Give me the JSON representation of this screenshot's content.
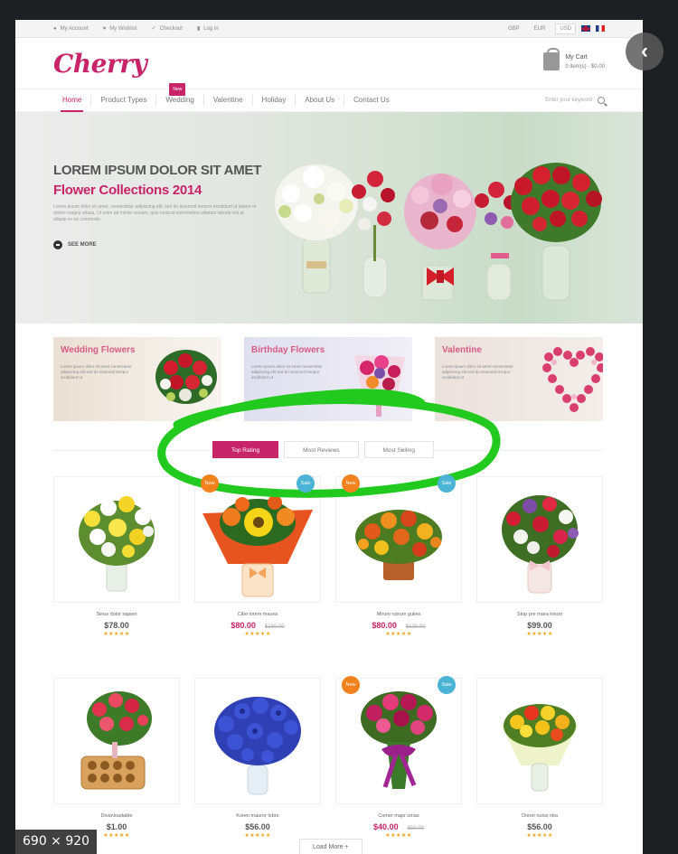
{
  "topbar": {
    "links": [
      "My Account",
      "My Wishlist",
      "Checkout",
      "Log in"
    ],
    "currencies": [
      "GBP",
      "EUR",
      "USD"
    ],
    "active_currency": "USD"
  },
  "header": {
    "logo": "Cherry",
    "cart_title": "My Cart",
    "cart_summary": "0 item(s) - $0.00"
  },
  "nav": {
    "items": [
      "Home",
      "Product Types",
      "Wedding",
      "Valentine",
      "Holiday",
      "About Us",
      "Contact Us"
    ],
    "new_badge": "New",
    "search_placeholder": "Enter your keyword"
  },
  "hero": {
    "title": "LOREM IPSUM DOLOR SIT AMET",
    "subtitle": "Flower Collections 2014",
    "body": "Lorem ipsum dolor sit amet, consectetur adipiscing elit, sed do eiusmod tempor incididunt ut labore et dolore magna aliqua. Ut enim ad minim veniam, quis nostrud exercitation ullamco laboris nisi ut aliquip ex ea commodo.",
    "cta": "SEE MORE"
  },
  "categories": [
    {
      "title": "Wedding Flowers",
      "text": "Lorem ipsum dolor sit amet consectetur adipiscing elit sed do eiusmod tempor incididunt ut"
    },
    {
      "title": "Birthday Flowers",
      "text": "Lorem ipsum dolor sit amet consectetur adipiscing elit sed do eiusmod tempor incididunt ut"
    },
    {
      "title": "Valentine",
      "text": "Lorem ipsum dolor sit amet consectetur adipiscing elit sed do eiusmod tempor incididunt ut"
    }
  ],
  "tabs": [
    "Top Rating",
    "Most Reviews",
    "Most Selling"
  ],
  "products": [
    {
      "name": "Sinus dolor sapien",
      "price": "$78.00",
      "old": "",
      "stars": "★★★★★",
      "new": "",
      "sale": ""
    },
    {
      "name": "Cibo lorem mauris",
      "price": "$80.00",
      "old": "$100.00",
      "stars": "★★★★★",
      "new": "New",
      "sale": "Sale"
    },
    {
      "name": "Mirum rutrum gulies",
      "price": "$80.00",
      "old": "$100.00",
      "stars": "★★★★★",
      "new": "New",
      "sale": "Sale"
    },
    {
      "name": "Stop pre mara lorum",
      "price": "$99.00",
      "old": "",
      "stars": "★★★★★",
      "new": "",
      "sale": ""
    },
    {
      "name": "Downloadable",
      "price": "$1.00",
      "old": "",
      "stars": "★★★★★",
      "new": "",
      "sale": ""
    },
    {
      "name": "Koren mauror lobre",
      "price": "$56.00",
      "old": "",
      "stars": "★★★★★",
      "new": "",
      "sale": ""
    },
    {
      "name": "Comer mapr umas",
      "price": "$40.00",
      "old": "$50.00",
      "stars": "★★★★★",
      "new": "New",
      "sale": "Sale"
    },
    {
      "name": "Donet nulus nita",
      "price": "$56.00",
      "old": "",
      "stars": "★★★★★",
      "new": "",
      "sale": ""
    }
  ],
  "load_more": "Load More  +",
  "viewer": {
    "dimensions": "690 × 920",
    "close_glyph": "‹"
  }
}
